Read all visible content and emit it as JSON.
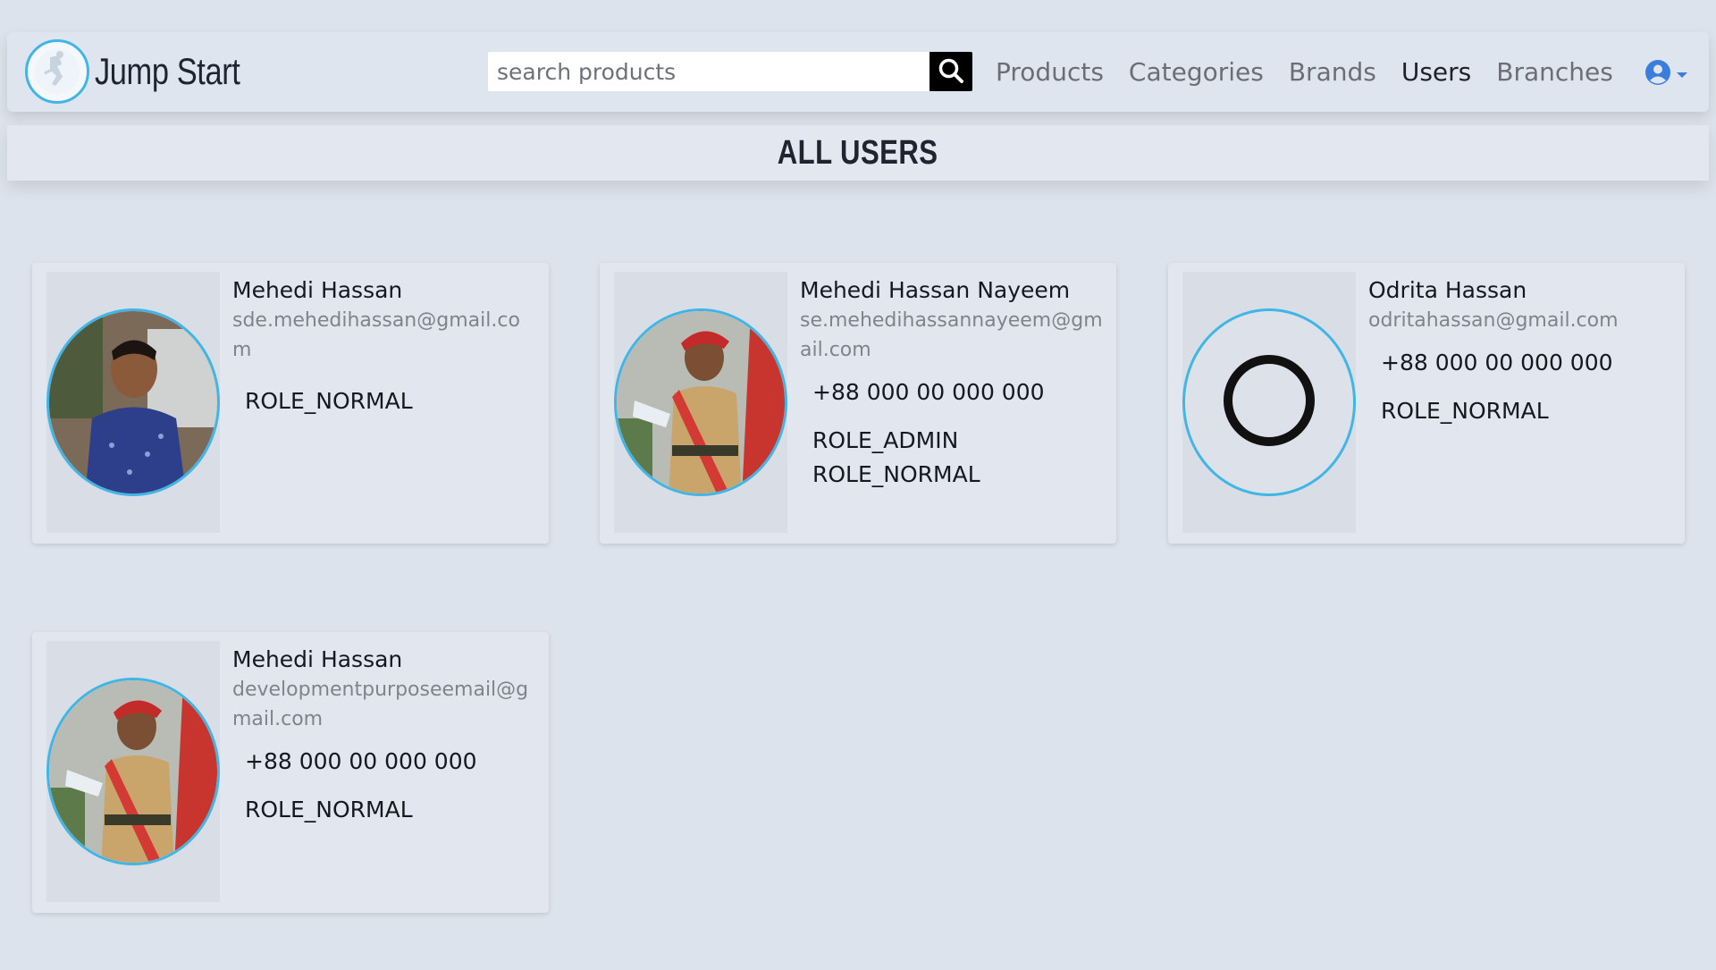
{
  "navbar": {
    "brand": "Jump Start",
    "search": {
      "placeholder": "search products",
      "value": ""
    },
    "links": [
      {
        "label": "Products",
        "active": false
      },
      {
        "label": "Categories",
        "active": false
      },
      {
        "label": "Brands",
        "active": false
      },
      {
        "label": "Users",
        "active": true
      },
      {
        "label": "Branches",
        "active": false
      }
    ],
    "account_icon": "user-circle-icon",
    "accent_color": "#41b6e6"
  },
  "page": {
    "title": "ALL USERS"
  },
  "users": [
    {
      "name": "Mehedi Hassan",
      "email": "sde.mehedihassan@gmail.com",
      "phone": "",
      "roles": [
        "ROLE_NORMAL"
      ],
      "avatar": "photo-blue-shirt"
    },
    {
      "name": "Mehedi Hassan Nayeem",
      "email": "se.mehedihassannayeem@gmail.com",
      "phone": "+88 000 00 000 000",
      "roles": [
        "ROLE_ADMIN",
        "ROLE_NORMAL"
      ],
      "avatar": "photo-uniform"
    },
    {
      "name": "Odrita Hassan",
      "email": "odritahassan@gmail.com",
      "phone": "+88 000 00 000 000",
      "roles": [
        "ROLE_NORMAL"
      ],
      "avatar": "placeholder-circle-icon"
    },
    {
      "name": "Mehedi Hassan",
      "email": "developmentpurposeemail@gmail.com",
      "phone": "+88 000 00 000 000",
      "roles": [
        "ROLE_NORMAL"
      ],
      "avatar": "photo-uniform"
    }
  ]
}
